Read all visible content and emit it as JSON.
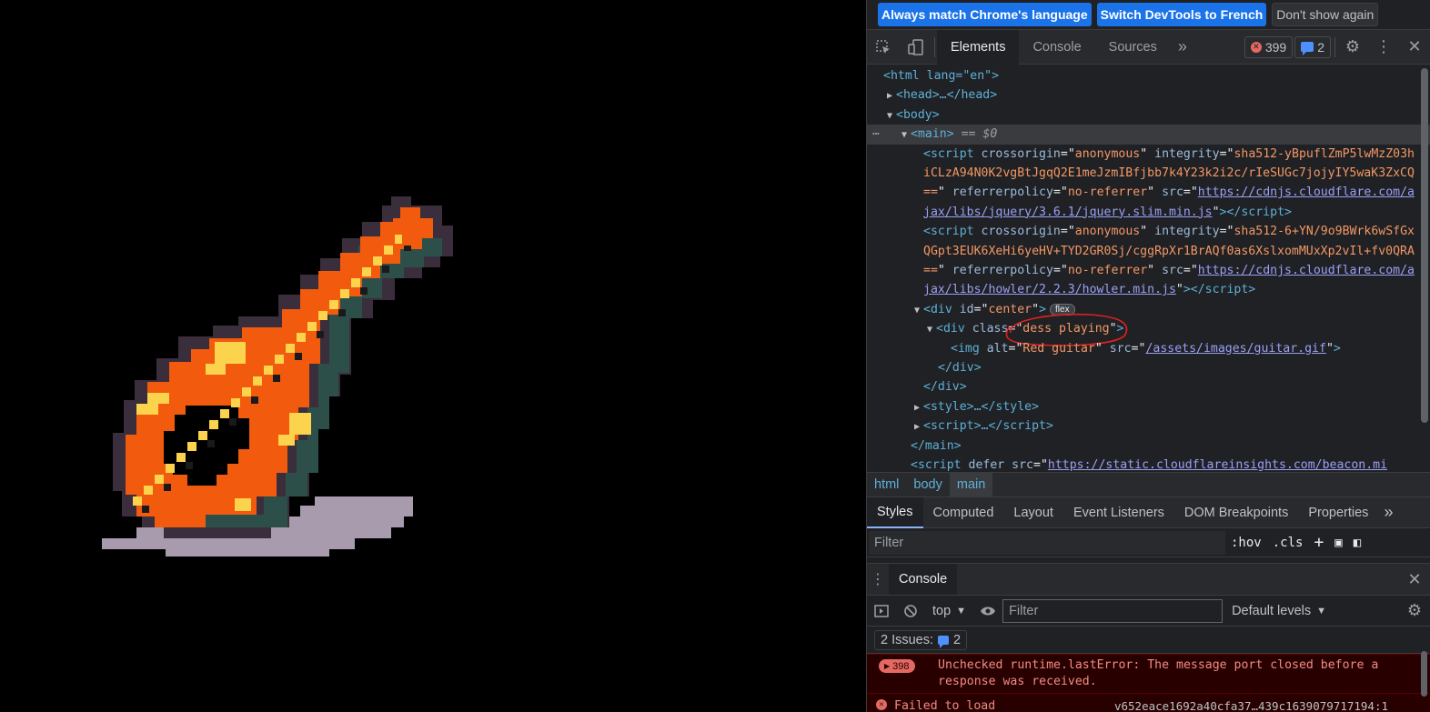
{
  "page": {
    "image_alt": "Red guitar",
    "colors": {
      "background": "#000000",
      "body": "#f25a0d",
      "accent": "#fcd34d",
      "outline": "#3a2e3c",
      "shadow": "#a89bad",
      "neck_side": "#2d4f4a"
    }
  },
  "infobar": {
    "match_language": "Always match Chrome's language",
    "switch_language": "Switch DevTools to French",
    "dont_show": "Don't show again"
  },
  "toolbar": {
    "tabs": [
      "Elements",
      "Console",
      "Sources"
    ],
    "more_tabs": "»",
    "error_count": "399",
    "issue_count": "2"
  },
  "dom": {
    "html_open": "<html lang=\"en\">",
    "head": "<head>…</head>",
    "body_open": "<body>",
    "main_open": "<main>",
    "main_suffix": "== $0",
    "script1": {
      "crossorigin": "anonymous",
      "integrity": "sha512-yBpuflZmP5lwMzZ03hiCLzA94N0K2vgBtJgqQ2E1meJzmIBfjbb7k4Y23k2i2c/rIeSUGc7jojyIY5waK3ZxCQ==",
      "referrerpolicy": "no-referrer",
      "src": "https://cdnjs.cloudflare.com/ajax/libs/jquery/3.6.1/jquery.slim.min.js"
    },
    "script2": {
      "crossorigin": "anonymous",
      "integrity": "sha512-6+YN/9o9BWrk6wSfGxQGpt3EUK6XeHi6yeHV+TYD2GR0Sj/cggRpXr1BrAQf0as6XslxomMUxXp2vIl+fv0QRA==",
      "referrerpolicy": "no-referrer",
      "src": "https://cdnjs.cloudflare.com/ajax/libs/howler/2.2.3/howler.min.js"
    },
    "div_center_id": "center",
    "flex_badge": "flex",
    "div_dess_class": "dess playing",
    "img_alt": "Red guitar",
    "img_src": "/assets/images/guitar.gif",
    "beacon_src": "https://static.cloudflareinsights.com/beacon.mi"
  },
  "breadcrumbs": [
    "html",
    "body",
    "main"
  ],
  "styles_tabs": [
    "Styles",
    "Computed",
    "Layout",
    "Event Listeners",
    "DOM Breakpoints",
    "Properties"
  ],
  "styles_filter": {
    "placeholder": "Filter",
    "hov": ":hov",
    "cls": ".cls"
  },
  "drawer": {
    "tab": "Console",
    "context": "top",
    "filter_placeholder": "Filter",
    "levels": "Default levels",
    "issues_label": "2 Issues:",
    "issues_count": "2"
  },
  "console_messages": [
    {
      "count": "398",
      "text": "Unchecked runtime.lastError: The message port closed before a response was received."
    },
    {
      "text": "Failed to load",
      "source": "v652eace1692a40cfa37…439c1639079717194:1"
    }
  ]
}
